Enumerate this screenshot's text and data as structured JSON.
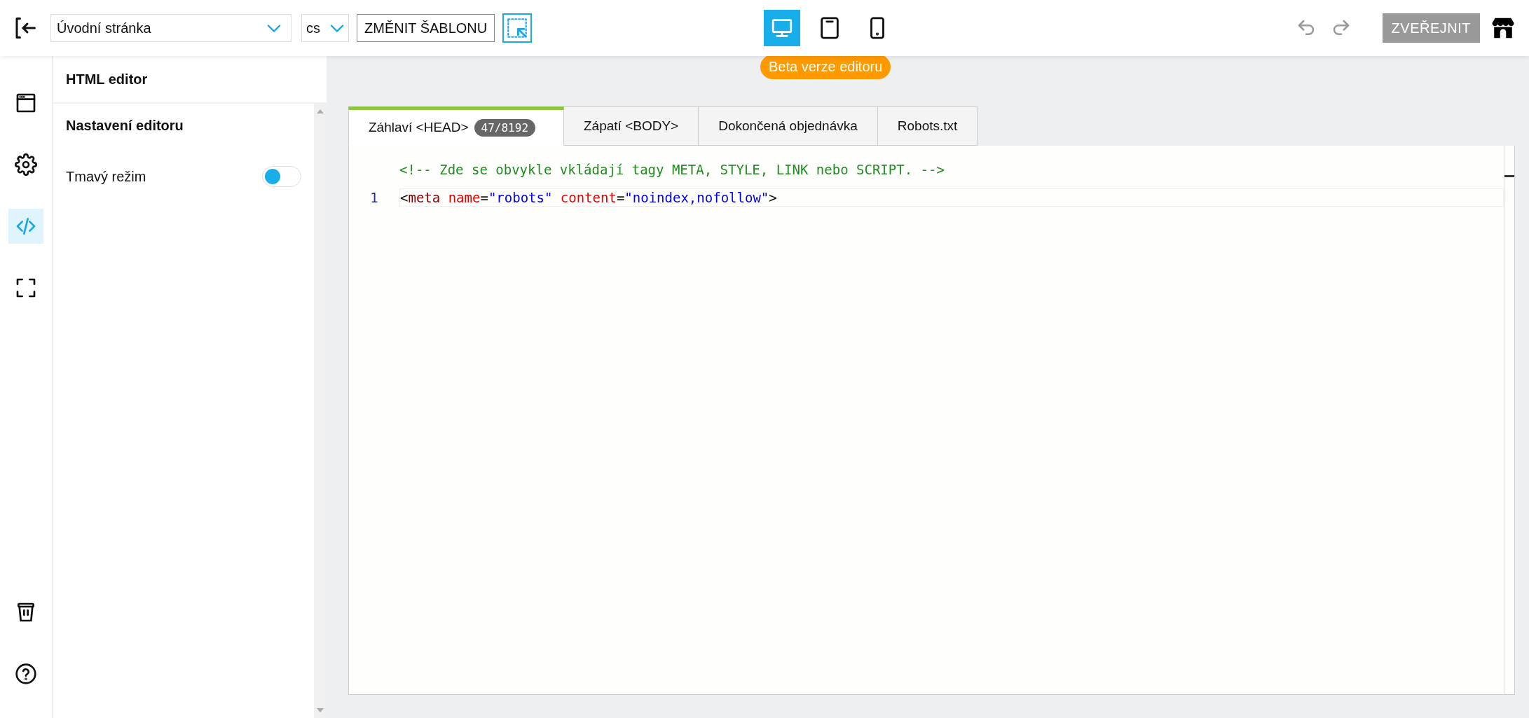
{
  "toolbar": {
    "page_select": {
      "value": "Úvodní stránka"
    },
    "language_select": {
      "value": "cs"
    },
    "change_template_button": "ZMĚNIT ŠABLONU",
    "devices": [
      {
        "kind": "desktop",
        "selected": true
      },
      {
        "kind": "tablet",
        "selected": false
      },
      {
        "kind": "phone",
        "selected": false
      }
    ],
    "publish_button": "ZVEŘEJNIT",
    "beta_badge": "Beta verze editoru"
  },
  "rail": [
    {
      "kind": "window",
      "selected": false
    },
    {
      "kind": "settings",
      "selected": false
    },
    {
      "kind": "code",
      "selected": true
    },
    {
      "kind": "fullscreen",
      "selected": false
    }
  ],
  "rail_bottom": [
    {
      "kind": "trash"
    },
    {
      "kind": "help"
    }
  ],
  "panel": {
    "title": "HTML editor",
    "section": "Nastavení editoru",
    "settings": [
      {
        "label": "Tmavý režim",
        "on": false
      }
    ]
  },
  "editor": {
    "tabs": [
      {
        "label": "Záhlaví <HEAD>",
        "count": "47/8192",
        "selected": true
      },
      {
        "label": "Zápatí <BODY>",
        "selected": false
      },
      {
        "label": "Dokončená objednávka",
        "selected": false
      },
      {
        "label": "Robots.txt",
        "selected": false
      }
    ],
    "placeholder": "<!-- Zde se obvykle vkládají tagy META, STYLE, LINK nebo SCRIPT. -->",
    "lines": [
      {
        "number": "1",
        "tokens": [
          {
            "kind": "punct",
            "text": "<"
          },
          {
            "kind": "tag",
            "text": "meta"
          },
          {
            "kind": "attr",
            "text": " name"
          },
          {
            "kind": "punct",
            "text": "="
          },
          {
            "kind": "string",
            "text": "\"robots\""
          },
          {
            "kind": "attr",
            "text": " content"
          },
          {
            "kind": "punct",
            "text": "="
          },
          {
            "kind": "string",
            "text": "\"noindex,nofollow\""
          },
          {
            "kind": "punct",
            "text": ">"
          }
        ]
      }
    ]
  }
}
